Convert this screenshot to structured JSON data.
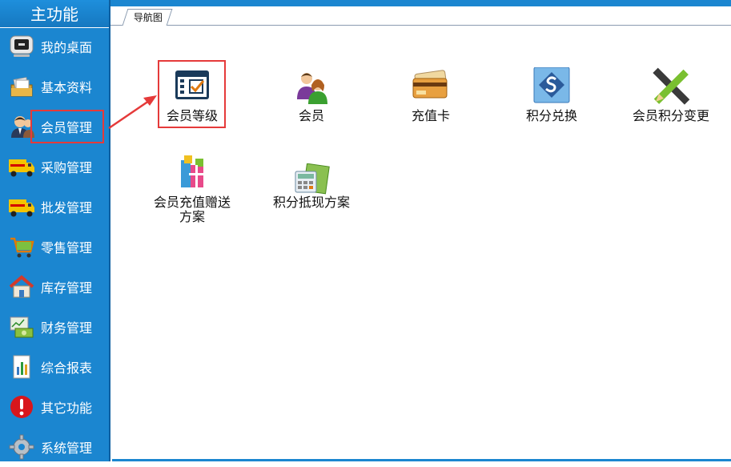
{
  "sidebar": {
    "title": "主功能",
    "items": [
      {
        "label": "我的桌面",
        "icon": "monitor-icon"
      },
      {
        "label": "基本资料",
        "icon": "folder-icon"
      },
      {
        "label": "会员管理",
        "icon": "member-icon"
      },
      {
        "label": "采购管理",
        "icon": "truck-icon"
      },
      {
        "label": "批发管理",
        "icon": "truck-icon"
      },
      {
        "label": "零售管理",
        "icon": "shopping-cart-icon"
      },
      {
        "label": "库存管理",
        "icon": "house-icon"
      },
      {
        "label": "财务管理",
        "icon": "money-icon"
      },
      {
        "label": "综合报表",
        "icon": "report-icon"
      },
      {
        "label": "其它功能",
        "icon": "alert-icon"
      },
      {
        "label": "系统管理",
        "icon": "gear-icon"
      }
    ],
    "selected": "会员管理"
  },
  "tabs": [
    {
      "label": "导航图"
    }
  ],
  "tiles": [
    {
      "label": "会员等级",
      "icon": "member-level-icon"
    },
    {
      "label": "会员",
      "icon": "members-icon"
    },
    {
      "label": "充值卡",
      "icon": "card-icon"
    },
    {
      "label": "积分兑换",
      "icon": "points-exchange-icon"
    },
    {
      "label": "会员积分变更",
      "icon": "pencil-ruler-icon"
    },
    {
      "label": "会员充值赠送方案",
      "icon": "gift-icon"
    },
    {
      "label": "积分抵现方案",
      "icon": "calculator-icon"
    }
  ],
  "colors": {
    "sidebar": "#1b86d0",
    "highlight": "#e53a3a"
  }
}
